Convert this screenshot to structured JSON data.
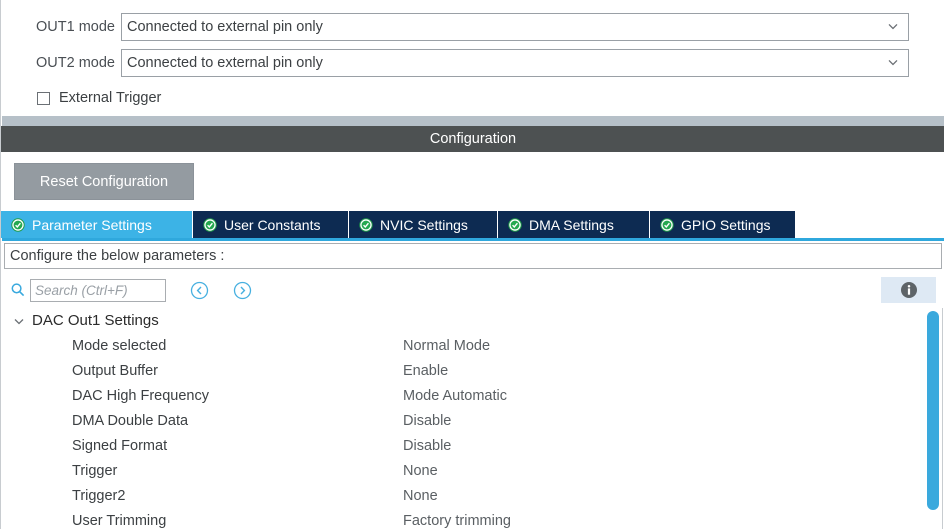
{
  "top_panel": {
    "fields": [
      {
        "label": "OUT1 mode",
        "value": "Connected to external pin only",
        "icon": "chevron-down-icon"
      },
      {
        "label": "OUT2 mode",
        "value": "Connected to external pin only",
        "icon": "chevron-down-icon"
      }
    ],
    "checkbox": {
      "label": "External Trigger",
      "checked": false
    }
  },
  "config_header": {
    "title": "Configuration"
  },
  "reset_button": {
    "label": "Reset Configuration"
  },
  "tabs": [
    {
      "label": "Parameter Settings",
      "active": true,
      "icon": "green-check-icon"
    },
    {
      "label": "User Constants",
      "active": false,
      "icon": "green-check-icon"
    },
    {
      "label": "NVIC Settings",
      "active": false,
      "icon": "green-check-icon"
    },
    {
      "label": "DMA Settings",
      "active": false,
      "icon": "green-check-icon"
    },
    {
      "label": "GPIO Settings",
      "active": false,
      "icon": "green-check-icon"
    }
  ],
  "configure_bar": {
    "text": "Configure the below parameters :"
  },
  "search": {
    "placeholder": "Search (Ctrl+F)",
    "value": "",
    "icon": "search-icon",
    "prev_icon": "circle-arrow-left-icon",
    "next_icon": "circle-arrow-right-icon"
  },
  "info_button": {
    "icon": "info-icon"
  },
  "tree": {
    "group": {
      "label": "DAC Out1 Settings",
      "expanded": true,
      "icon": "chevron-down-icon"
    },
    "rows": [
      {
        "name": "Mode selected",
        "value": "Normal Mode"
      },
      {
        "name": "Output Buffer",
        "value": "Enable"
      },
      {
        "name": "DAC High Frequency",
        "value": "Mode Automatic"
      },
      {
        "name": "DMA Double Data",
        "value": "Disable"
      },
      {
        "name": "Signed Format",
        "value": "Disable"
      },
      {
        "name": "Trigger",
        "value": "None"
      },
      {
        "name": "Trigger2",
        "value": "None"
      },
      {
        "name": "User Trimming",
        "value": "Factory trimming"
      }
    ]
  },
  "colors": {
    "tab_active": "#3cb3e6",
    "tab_inactive": "#0d2b52",
    "header_bar": "#4d5152",
    "band": "#b6c0c8",
    "accent_blue": "#2fa8dd",
    "scrollbar": "#3aa9dd",
    "reset_button": "#949ba1"
  }
}
